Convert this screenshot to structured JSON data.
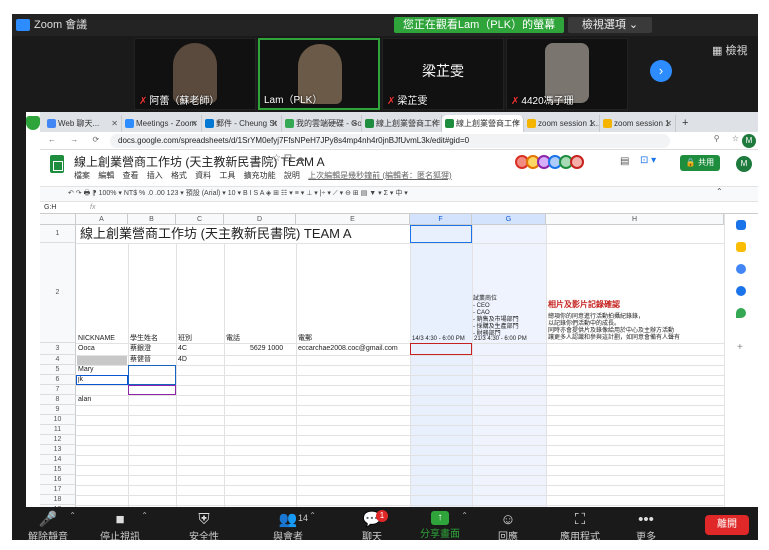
{
  "zoom": {
    "title": "Zoom 會議",
    "share_banner": "您正在觀看Lam（PLK）的螢幕",
    "view_options": "檢視選項 ⌄",
    "gallery_view": "▦ 檢視",
    "participants": [
      {
        "name": "阿蕾（蘇老師）",
        "muted": true
      },
      {
        "name": "Lam（PLK）",
        "muted": false
      },
      {
        "name": "梁芷雯",
        "muted": true
      },
      {
        "name": "4420馮子珊",
        "muted": true
      }
    ],
    "center_name": "梁芷雯",
    "controls": [
      {
        "label": "解除靜音",
        "icon": "mic-muted-icon"
      },
      {
        "label": "停止視訊",
        "icon": "video-icon"
      },
      {
        "label": "安全性",
        "icon": "shield-icon"
      },
      {
        "label": "與會者",
        "icon": "participants-icon",
        "count": "14"
      },
      {
        "label": "聊天",
        "icon": "chat-icon",
        "badge": "1"
      },
      {
        "label": "分享畫面",
        "icon": "share-screen-icon"
      },
      {
        "label": "回應",
        "icon": "reaction-icon"
      },
      {
        "label": "應用程式",
        "icon": "apps-icon"
      },
      {
        "label": "更多",
        "icon": "more-icon"
      }
    ],
    "leave": "離開"
  },
  "browser": {
    "tabs": [
      {
        "label": "Web 聊天...",
        "color": "#4285f4"
      },
      {
        "label": "Meetings - Zoom",
        "color": "#2d8cff"
      },
      {
        "label": "郵件 - Cheung St",
        "color": "#0078d4"
      },
      {
        "label": "我的雲端硬碟 - Go",
        "color": "#34a853"
      },
      {
        "label": "線上創業營商工作",
        "color": "#1e8e3e"
      },
      {
        "label": "線上創業營商工作",
        "color": "#1e8e3e"
      },
      {
        "label": "zoom session 1...",
        "color": "#f4b400"
      },
      {
        "label": "zoom session 1",
        "color": "#f4b400"
      }
    ],
    "url": "docs.google.com/spreadsheets/d/1SrYM0efyj7FfsNPeH7JPy8s4mp4nh4r0jnBJfUvmL3k/edit#gid=0"
  },
  "sheet": {
    "title": "線上創業營商工作坊 (天主教新民書院) TEAM A",
    "menu": [
      "檔案",
      "編輯",
      "查看",
      "插入",
      "格式",
      "資料",
      "工具",
      "擴充功能",
      "說明"
    ],
    "last_edit": "上次編輯是幾秒鐘前 (編輯者：匿名狐狸)",
    "share": "共用",
    "account_initial": "M",
    "toolbar": "↶  ↷  🖶  ⁋     100% ▾    NT$   %   .0   .00   123 ▾     預設 (Arial) ▾     10 ▾     B   I   S   A     ◈   ⊞   ☷ ▾     ≡ ▾   ⊥ ▾   |÷ ▾   ⟋ ▾     ⊖   ⊞   ▤   ▼ ▾   Σ ▾     中 ▾",
    "name_box": "G:H",
    "fx": "fx",
    "columns": [
      "A",
      "B",
      "C",
      "D",
      "E",
      "F",
      "G",
      "H",
      "I"
    ],
    "banner": "線上創業營商工作坊 (天主教新民書院) TEAM A",
    "headers": [
      "NICKNAME",
      "學生姓名",
      "班別",
      "電話",
      "電郵",
      "14/3 4:30 - 6:00 PM",
      "21/3 4:30 - 6:00 PM"
    ],
    "dept_header": [
      "試業崗位",
      "- CEO",
      "- CAO",
      "- 銷售及市場部門",
      "- 採購及生產部門",
      "- 財務部門"
    ],
    "consent_title": "相片及影片記錄確認",
    "consent_text": [
      "總項你的同意進行活動拍攝紀錄錄，",
      "以記錄你們活動中的成長。",
      "同時亦會提供片及錄像給用於中心及主辦方活動",
      "讓更多人認識和參與這計劃，如同意會備有人聲有"
    ],
    "rows": [
      {
        "nickname": "Ooca",
        "name": "蔡銀澄",
        "cls": "4C",
        "phone": "5629 1000",
        "email": "eccarchae2008.coc@gmail.com"
      },
      {
        "nickname": "",
        "name": "蔡健晉",
        "cls": "4D",
        "phone": "",
        "email": ""
      },
      {
        "nickname": "Mary",
        "name": "",
        "cls": "",
        "phone": "",
        "email": ""
      },
      {
        "nickname": "jk",
        "name": "",
        "cls": "",
        "phone": "",
        "email": ""
      },
      {
        "nickname": "",
        "name": "",
        "cls": "",
        "phone": "",
        "email": ""
      },
      {
        "nickname": "alan",
        "name": "",
        "cls": "",
        "phone": "",
        "email": ""
      }
    ],
    "row_numbers": [
      "1",
      "2",
      "3",
      "4",
      "5",
      "6",
      "7",
      "8",
      "9",
      "10",
      "11",
      "12",
      "13",
      "14",
      "15",
      "16",
      "17",
      "18",
      "19"
    ]
  }
}
